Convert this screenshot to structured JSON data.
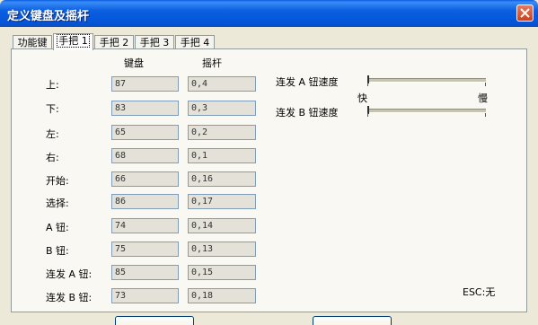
{
  "window": {
    "title": "定义键盘及摇杆",
    "close_icon": "close-icon"
  },
  "tabs": [
    {
      "label": "功能键",
      "active": false
    },
    {
      "label": "手把 1",
      "active": true
    },
    {
      "label": "手把 2",
      "active": false
    },
    {
      "label": "手把 3",
      "active": false
    },
    {
      "label": "手把 4",
      "active": false
    }
  ],
  "columns": {
    "keyboard": "键盘",
    "joystick": "摇杆"
  },
  "rows": [
    {
      "label": "上:",
      "keyboard": "87",
      "joystick": "0,4"
    },
    {
      "label": "下:",
      "keyboard": "83",
      "joystick": "0,3"
    },
    {
      "label": "左:",
      "keyboard": "65",
      "joystick": "0,2"
    },
    {
      "label": "右:",
      "keyboard": "68",
      "joystick": "0,1"
    },
    {
      "label": "开始:",
      "keyboard": "66",
      "joystick": "0,16"
    },
    {
      "label": "选择:",
      "keyboard": "86",
      "joystick": "0,17"
    },
    {
      "label": "A 钮:",
      "keyboard": "74",
      "joystick": "0,14"
    },
    {
      "label": "B 钮:",
      "keyboard": "75",
      "joystick": "0,13"
    },
    {
      "label": "连发 A 钮:",
      "keyboard": "85",
      "joystick": "0,15"
    },
    {
      "label": "连发 B 钮:",
      "keyboard": "73",
      "joystick": "0,18"
    }
  ],
  "turbo": {
    "a_label": "连发 A 钮速度",
    "b_label": "连发 B 钮速度",
    "fast_label": "快",
    "slow_label": "慢",
    "a_value": 0,
    "b_value": 0
  },
  "esc_text": "ESC:无",
  "colors": {
    "titlebar": "#0554d8",
    "panel": "#f9f8f3",
    "field": "#e3e1d8"
  }
}
